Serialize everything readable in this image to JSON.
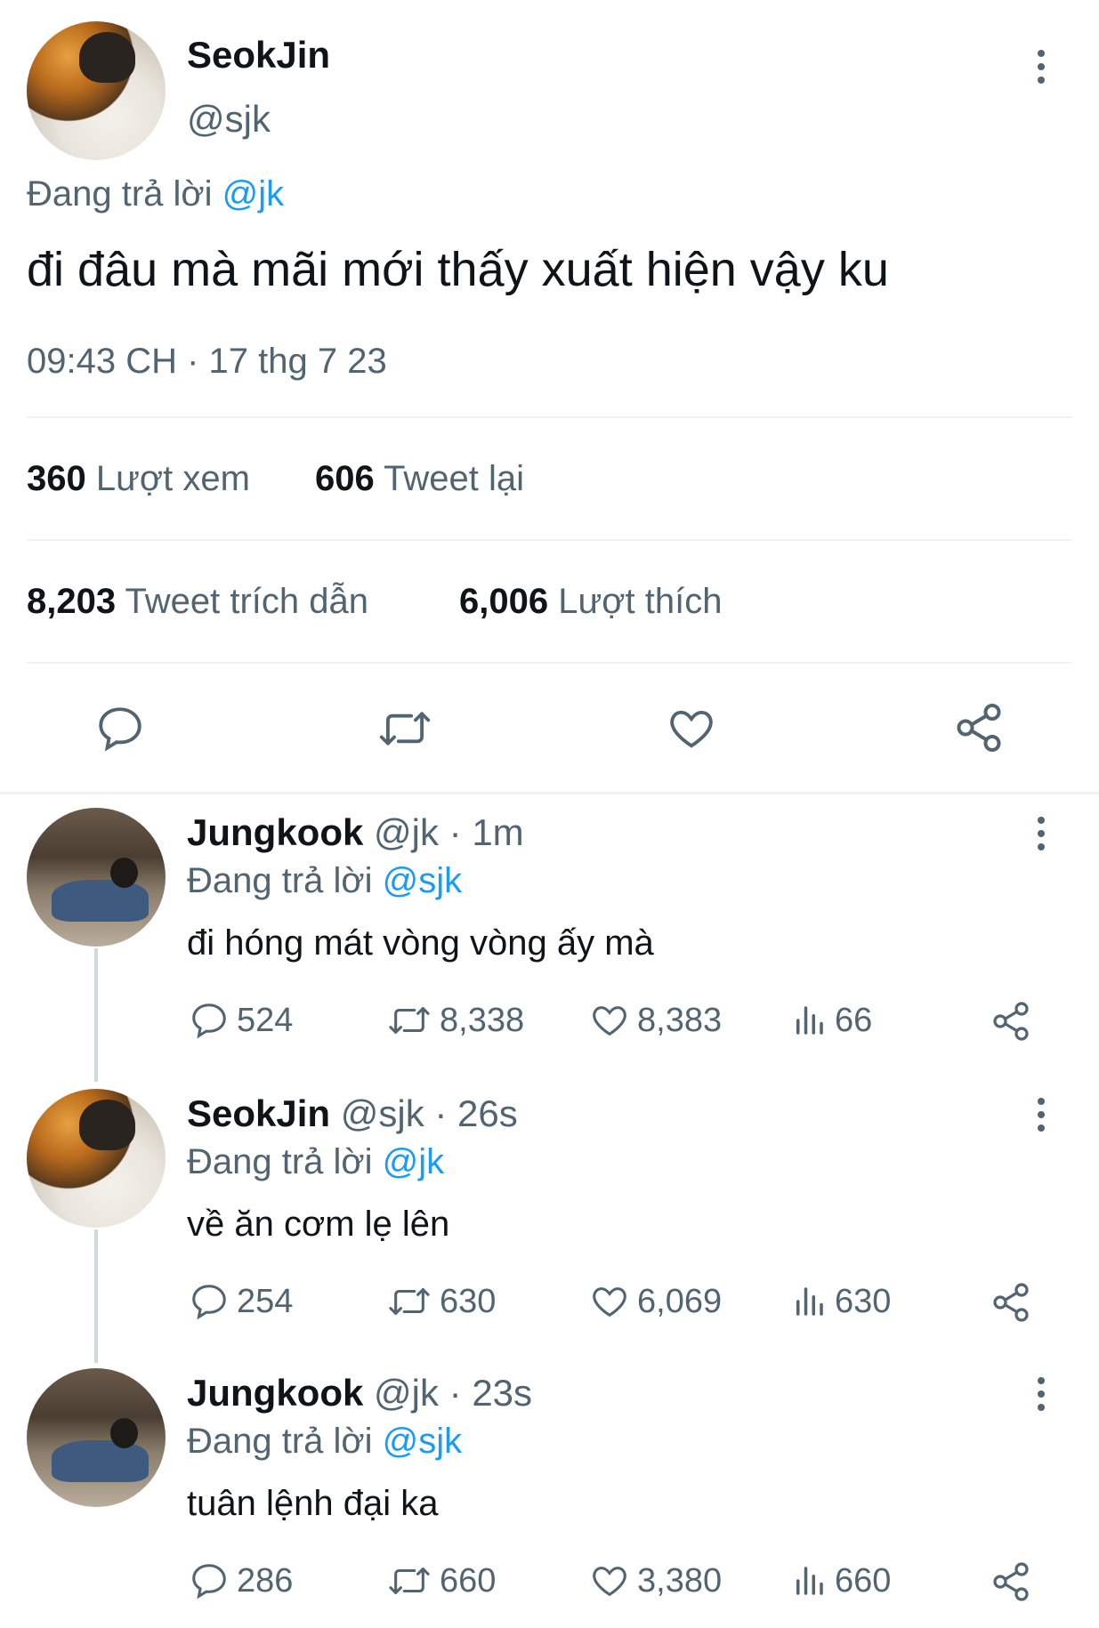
{
  "main_tweet": {
    "author_name": "SeokJin",
    "author_handle": "@sjk",
    "replying_prefix": "Đang trả lời",
    "replying_to": "@jk",
    "text": "đi đâu mà mãi mới thấy xuất hiện vậy ku",
    "timestamp": "09:43 CH · 17 thg 7 23",
    "views_count": "360",
    "views_label": "Lượt xem",
    "retweets_count": "606",
    "retweets_label": "Tweet lại",
    "quotes_count": "8,203",
    "quotes_label": "Tweet trích dẫn",
    "likes_count": "6,006",
    "likes_label": "Lượt thích"
  },
  "replies": [
    {
      "author_name": "Jungkook",
      "meta": "@jk · 1m",
      "replying_prefix": "Đang trả lời",
      "replying_to": "@sjk",
      "text": "đi hóng mát vòng vòng ấy mà",
      "replies": "524",
      "retweets": "8,338",
      "likes": "8,383",
      "views": "66"
    },
    {
      "author_name": "SeokJin",
      "meta": "@sjk · 26s",
      "replying_prefix": "Đang trả lời",
      "replying_to": "@jk",
      "text": "về ăn cơm lẹ lên",
      "replies": "254",
      "retweets": "630",
      "likes": "6,069",
      "views": "630"
    },
    {
      "author_name": "Jungkook",
      "meta": "@jk · 23s",
      "replying_prefix": "Đang trả lời",
      "replying_to": "@sjk",
      "text": "tuân lệnh đại ka",
      "replies": "286",
      "retweets": "660",
      "likes": "3,380",
      "views": "660"
    }
  ],
  "icons": {
    "reply": "speech-bubble-icon",
    "retweet": "retweet-icon",
    "like": "heart-icon",
    "share": "share-icon",
    "views": "bar-chart-icon",
    "more": "vertical-dots-icon"
  },
  "colors": {
    "accent": "#1d9bf0",
    "muted": "#536471",
    "text": "#0f1419"
  }
}
